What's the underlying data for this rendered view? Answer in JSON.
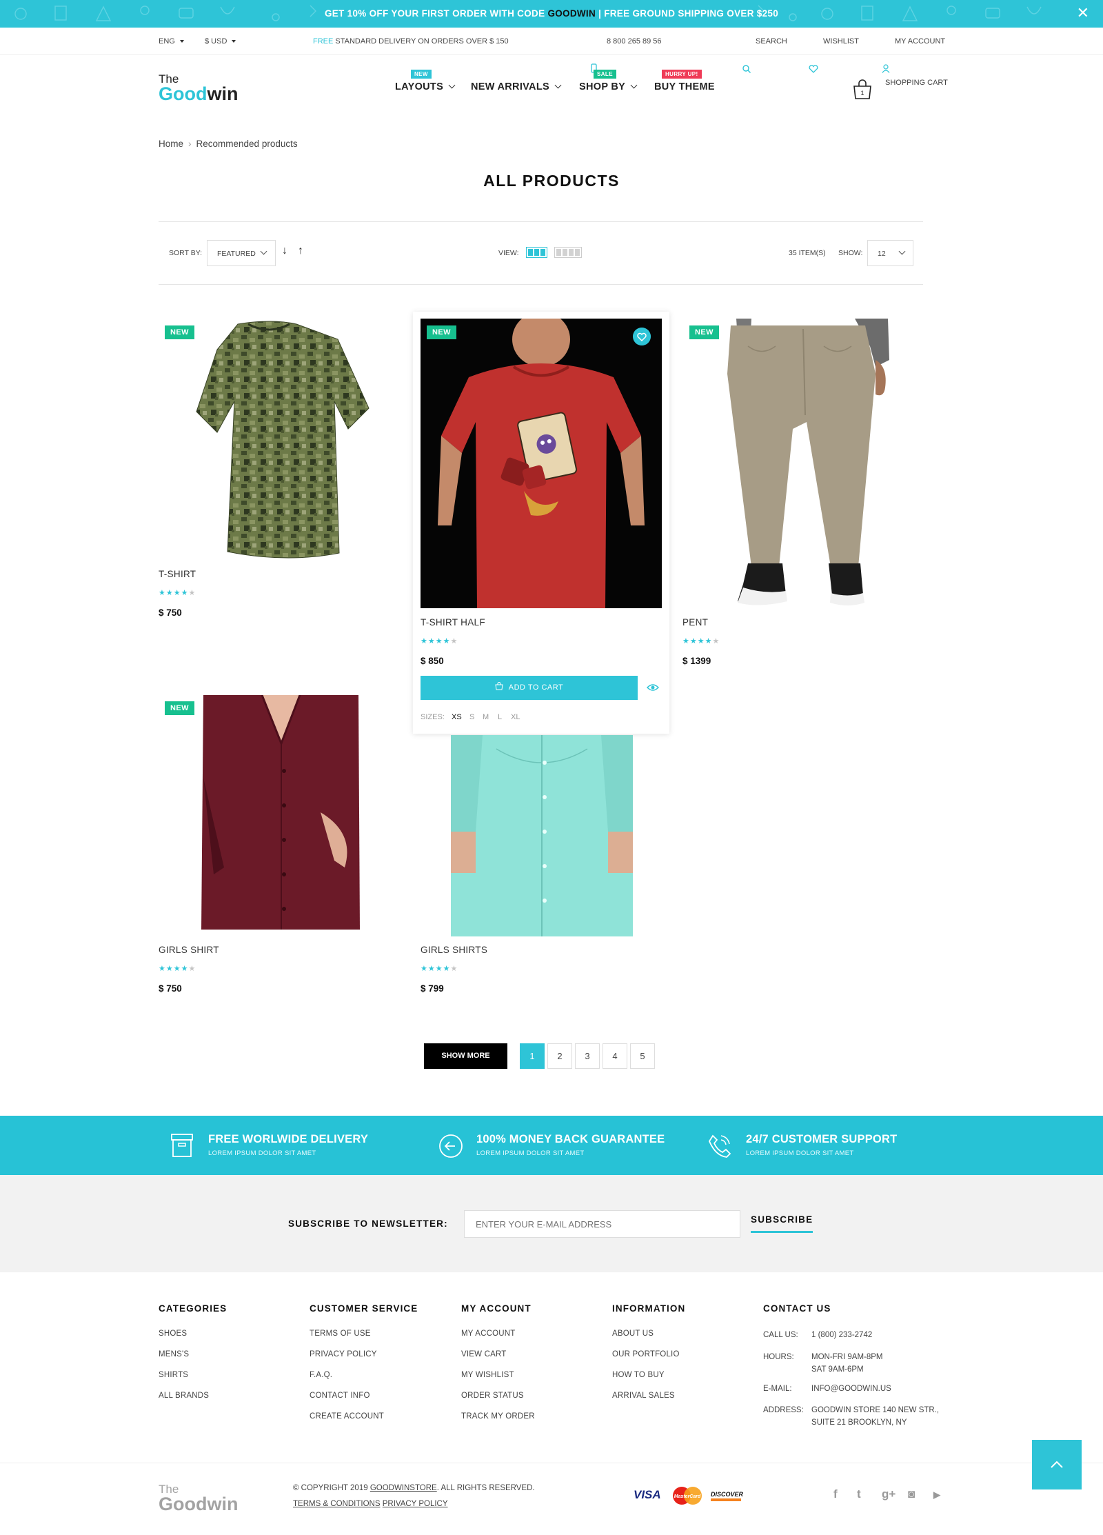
{
  "promo": {
    "text_before": "GET 10% OFF YOUR FIRST ORDER WITH CODE ",
    "code": "GOODWIN",
    "text_after": "  |  FREE GROUND SHIPPING OVER $250",
    "close": "✕"
  },
  "topbar": {
    "language": "ENG",
    "currency": "$ USD",
    "delivery_highlight": "FREE",
    "delivery_text": " STANDARD DELIVERY ON ORDERS OVER $ 150",
    "phone": "8 800 265 89 56",
    "search": "SEARCH",
    "wishlist": "WISHLIST",
    "account": "MY ACCOUNT"
  },
  "logo": {
    "the": "The",
    "good": "Good",
    "win": "win"
  },
  "nav": [
    {
      "label": "LAYOUTS",
      "badge": "NEW",
      "badge_color": "#2ec4d7"
    },
    {
      "label": "NEW ARRIVALS",
      "badge": "",
      "badge_color": ""
    },
    {
      "label": "SHOP BY",
      "badge": "SALE",
      "badge_color": "#17c08f"
    },
    {
      "label": "BUY THEME",
      "badge": "HURRY UP!",
      "badge_color": "#ef3b57"
    }
  ],
  "cart": {
    "label": "SHOPPING CART",
    "count": "1"
  },
  "breadcrumb": {
    "home": "Home",
    "current": "Recommended products"
  },
  "page_title": "ALL PRODUCTS",
  "toolbar": {
    "sort_label": "SORT BY:",
    "sort_value": "FEATURED",
    "view_label": "VIEW:",
    "items_count": "35 ITEM(S)",
    "show_label": "SHOW:",
    "show_value": "12"
  },
  "products": [
    {
      "name": "T-SHIRT",
      "price": "$ 750",
      "badge": "NEW",
      "rating": 4
    },
    {
      "name": "T-SHIRT HALF",
      "price": "$ 850",
      "badge": "NEW",
      "rating": 4
    },
    {
      "name": "PENT",
      "price": "$ 1399",
      "badge": "NEW",
      "rating": 4
    },
    {
      "name": "GIRLS SHIRT",
      "price": "$ 750",
      "badge": "NEW",
      "rating": 4
    },
    {
      "name": "GIRLS SHIRTS",
      "price": "$ 799",
      "badge": "",
      "rating": 4
    }
  ],
  "hover_card": {
    "add_to_cart": "ADD TO CART",
    "sizes_label": "SIZES:",
    "sizes": [
      "XS",
      "S",
      "M",
      "L",
      "XL"
    ],
    "selected_size": "XS"
  },
  "pagination": {
    "show_more": "SHOW MORE",
    "pages": [
      "1",
      "2",
      "3",
      "4",
      "5"
    ],
    "current": "1"
  },
  "features": [
    {
      "title": "FREE WORLWIDE DELIVERY",
      "sub": "LOREM IPSUM DOLOR SIT AMET",
      "icon": "box-icon"
    },
    {
      "title": "100% MONEY BACK GUARANTEE",
      "sub": "LOREM IPSUM DOLOR SIT AMET",
      "icon": "arrow-circle-icon"
    },
    {
      "title": "24/7 CUSTOMER SUPPORT",
      "sub": "LOREM IPSUM DOLOR SIT AMET",
      "icon": "phone-icon"
    }
  ],
  "newsletter": {
    "label": "SUBSCRIBE TO NEWSLETTER:",
    "placeholder": "ENTER YOUR E-MAIL ADDRESS",
    "button": "SUBSCRIBE"
  },
  "footer": {
    "columns": [
      {
        "title": "CATEGORIES",
        "links": [
          "SHOES",
          "MENS'S",
          "SHIRTS",
          "ALL BRANDS"
        ]
      },
      {
        "title": "CUSTOMER SERVICE",
        "links": [
          "TERMS OF USE",
          "PRIVACY POLICY",
          "F.A.Q.",
          "CONTACT INFO",
          "CREATE ACCOUNT"
        ]
      },
      {
        "title": "MY ACCOUNT",
        "links": [
          "MY ACCOUNT",
          "VIEW CART",
          "MY WISHLIST",
          "ORDER STATUS",
          "TRACK MY ORDER"
        ]
      },
      {
        "title": "INFORMATION",
        "links": [
          "ABOUT US",
          "OUR PORTFOLIO",
          "HOW TO BUY",
          "ARRIVAL SALES"
        ]
      }
    ],
    "contact": {
      "title": "CONTACT US",
      "call_label": "CALL US:",
      "call_value": "1 (800) 233-2742",
      "hours_label": "HOURS:",
      "hours_line1": "MON-FRI 9AM-8PM",
      "hours_line2": "SAT 9AM-6PM",
      "email_label": "E-MAIL:",
      "email_value": "INFO@GOODWIN.US",
      "address_label": "ADDRESS:",
      "address_line1": "GOODWIN STORE 140 NEW STR.,",
      "address_line2": "SUITE 21 BROOKLYN, NY"
    },
    "copyright_before": "© COPYRIGHT 2019 ",
    "copyright_link": "GOODWINSTORE",
    "copyright_after": ". ALL RIGHTS RESERVED.",
    "terms": "TERMS & CONDITIONS",
    "privacy": "PRIVACY POLICY",
    "payments": [
      "VISA",
      "MasterCard",
      "DISCOVER"
    ],
    "socials": [
      "facebook-icon",
      "twitter-icon",
      "google-plus-icon",
      "instagram-icon",
      "youtube-icon"
    ],
    "social_glyphs": [
      "f",
      "t",
      "g+",
      "◙",
      "▶"
    ]
  },
  "colors": {
    "accent": "#2ec4d7",
    "new_badge": "#17c08f",
    "hurry_badge": "#ef3b57",
    "dark": "#111111"
  }
}
